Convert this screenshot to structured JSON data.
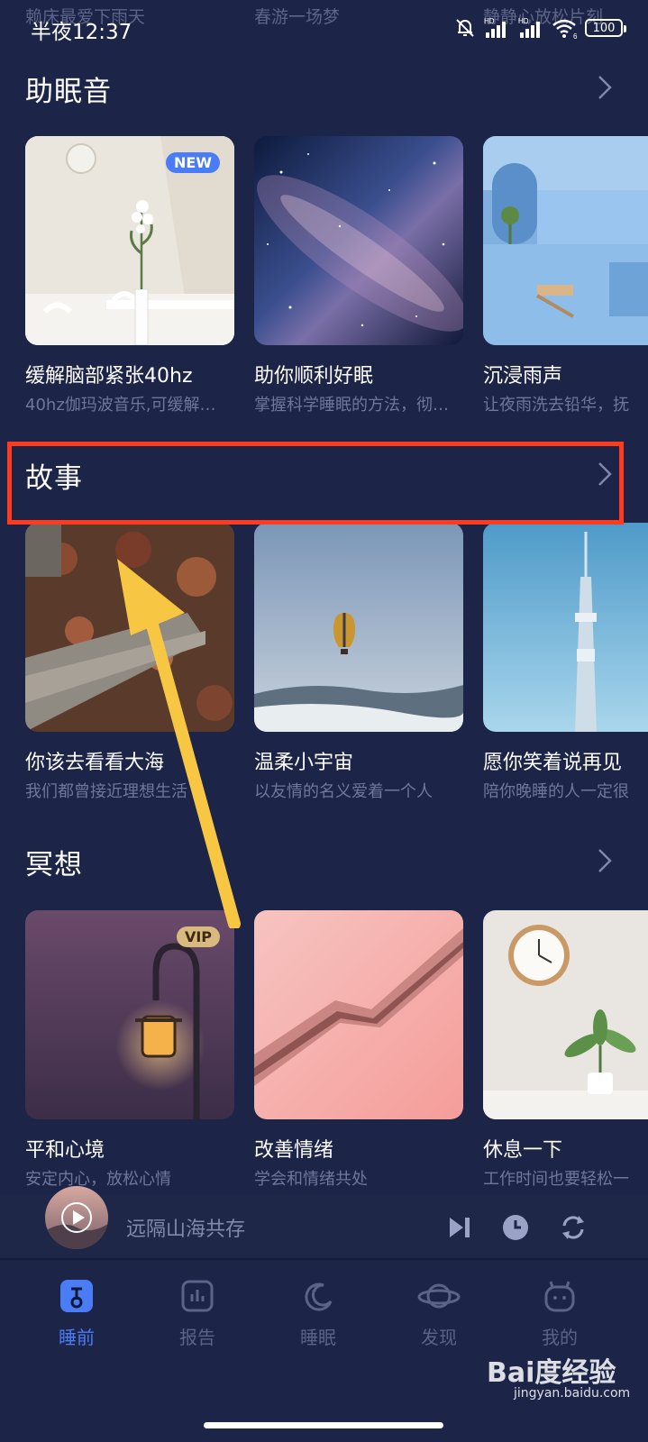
{
  "status_bar": {
    "time": "半夜12:37",
    "battery": "100",
    "hd_label": "HD",
    "wifi_badge": "6"
  },
  "prev_row_subtitles": [
    "赖床最爱下雨天",
    "春游一场梦",
    "静静心放松片刻"
  ],
  "sections": {
    "sleep_sounds": {
      "title": "助眠音",
      "cards": [
        {
          "title": "缓解脑部紧张40hz",
          "subtitle": "40hz伽玛波音乐,可缓解…",
          "badge": "NEW"
        },
        {
          "title": "助你顺利好眠",
          "subtitle": "掌握科学睡眠的方法，彻…"
        },
        {
          "title": "沉浸雨声",
          "subtitle": "让夜雨洗去铅华，抚"
        }
      ]
    },
    "stories": {
      "title": "故事",
      "cards": [
        {
          "title": "你该去看看大海",
          "subtitle": "我们都曾接近理想生活"
        },
        {
          "title": "温柔小宇宙",
          "subtitle": "以友情的名义爱着一个人"
        },
        {
          "title": "愿你笑着说再见",
          "subtitle": "陪你晚睡的人一定很"
        }
      ]
    },
    "meditation": {
      "title": "冥想",
      "cards": [
        {
          "title": "平和心境",
          "subtitle": "安定内心，放松心情",
          "badge": "VIP"
        },
        {
          "title": "改善情绪",
          "subtitle": "学会和情绪共处"
        },
        {
          "title": "休息一下",
          "subtitle": "工作时间也要轻松一"
        }
      ]
    }
  },
  "player": {
    "track": "远隔山海共存"
  },
  "tabs": [
    {
      "label": "睡前",
      "icon": "music-note-icon",
      "active": true
    },
    {
      "label": "报告",
      "icon": "chart-icon",
      "active": false
    },
    {
      "label": "睡眠",
      "icon": "moon-icon",
      "active": false
    },
    {
      "label": "发现",
      "icon": "planet-icon",
      "active": false
    },
    {
      "label": "我的",
      "icon": "profile-icon",
      "active": false
    }
  ],
  "watermark": {
    "brand": "Bai度经验",
    "url": "jingyan.baidu.com"
  },
  "colors": {
    "background": "#1c2447",
    "accent": "#4a7cf5",
    "highlight_box": "#ff3b1f",
    "arrow": "#f7c744",
    "subtitle": "#6e779c"
  }
}
